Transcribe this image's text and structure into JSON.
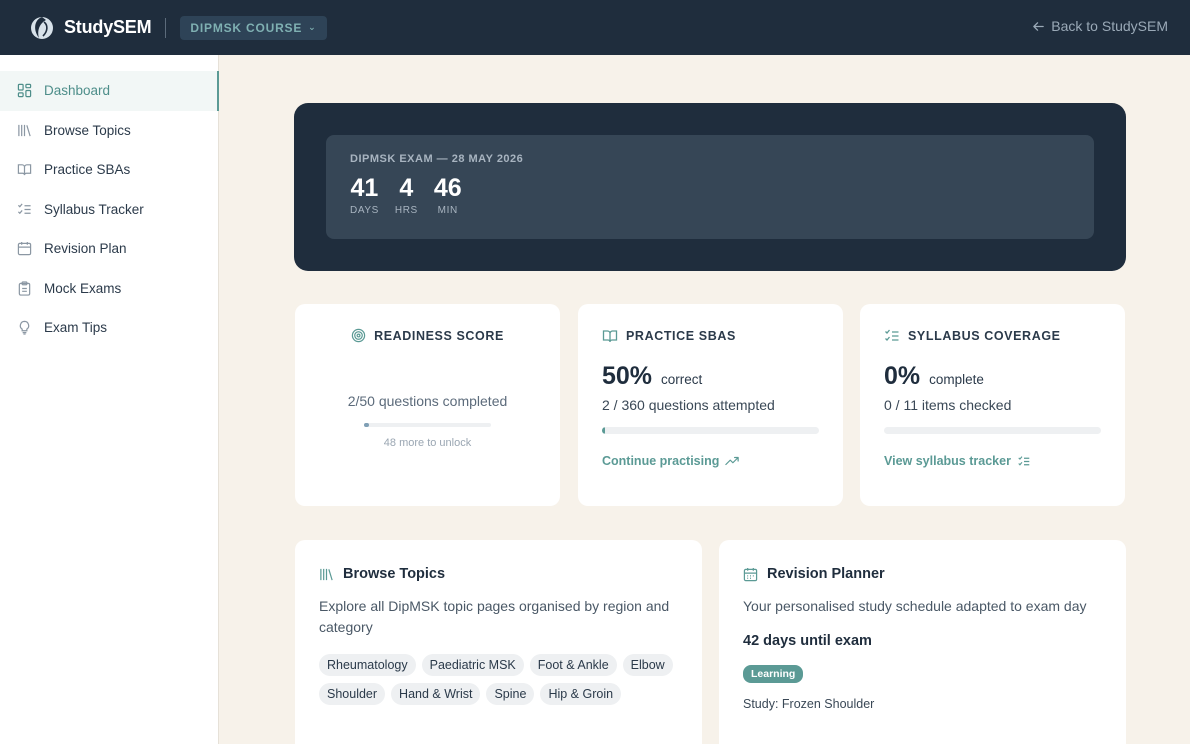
{
  "header": {
    "brand": "StudySEM",
    "course": "DIPMSK COURSE",
    "back_link": "Back to StudySEM"
  },
  "sidebar": {
    "items": [
      {
        "label": "Dashboard",
        "icon": "dashboard-grid-icon",
        "active": true
      },
      {
        "label": "Browse Topics",
        "icon": "library-books-icon",
        "active": false
      },
      {
        "label": "Practice SBAs",
        "icon": "open-book-icon",
        "active": false
      },
      {
        "label": "Syllabus Tracker",
        "icon": "checklist-icon",
        "active": false
      },
      {
        "label": "Revision Plan",
        "icon": "calendar-icon",
        "active": false
      },
      {
        "label": "Mock Exams",
        "icon": "clipboard-icon",
        "active": false
      },
      {
        "label": "Exam Tips",
        "icon": "lightbulb-icon",
        "active": false
      }
    ]
  },
  "countdown": {
    "label": "DIPMSK EXAM — 28 MAY 2026",
    "days": "41",
    "days_label": "DAYS",
    "hours": "4",
    "hours_label": "HRS",
    "minutes": "46",
    "minutes_label": "MIN"
  },
  "readiness": {
    "title": "READINESS SCORE",
    "progress_text": "2/50 questions completed",
    "progress_fraction": 0.04,
    "hint": "48 more to unlock"
  },
  "practice": {
    "title": "PRACTICE SBAS",
    "percent": "50%",
    "percent_label": "correct",
    "attempted": "2 / 360 questions attempted",
    "progress_fraction": 0.0056,
    "cta": "Continue practising"
  },
  "syllabus": {
    "title": "SYLLABUS COVERAGE",
    "percent": "0%",
    "percent_label": "complete",
    "checked": "0 / 11 items checked",
    "progress_fraction": 0,
    "cta": "View syllabus tracker"
  },
  "browse": {
    "title": "Browse Topics",
    "description": "Explore all DipMSK topic pages organised by region and category",
    "chips": [
      "Rheumatology",
      "Paediatric MSK",
      "Foot & Ankle",
      "Elbow",
      "Shoulder",
      "Hand & Wrist",
      "Spine",
      "Hip & Groin"
    ]
  },
  "planner": {
    "title": "Revision Planner",
    "description": "Your personalised study schedule adapted to exam day",
    "days_until": "42 days until exam",
    "badge": "Learning",
    "study": "Study: Frozen Shoulder"
  },
  "colors": {
    "navy": "#1f2d3d",
    "teal": "#5b9a95",
    "cream": "#f7f2ea"
  }
}
